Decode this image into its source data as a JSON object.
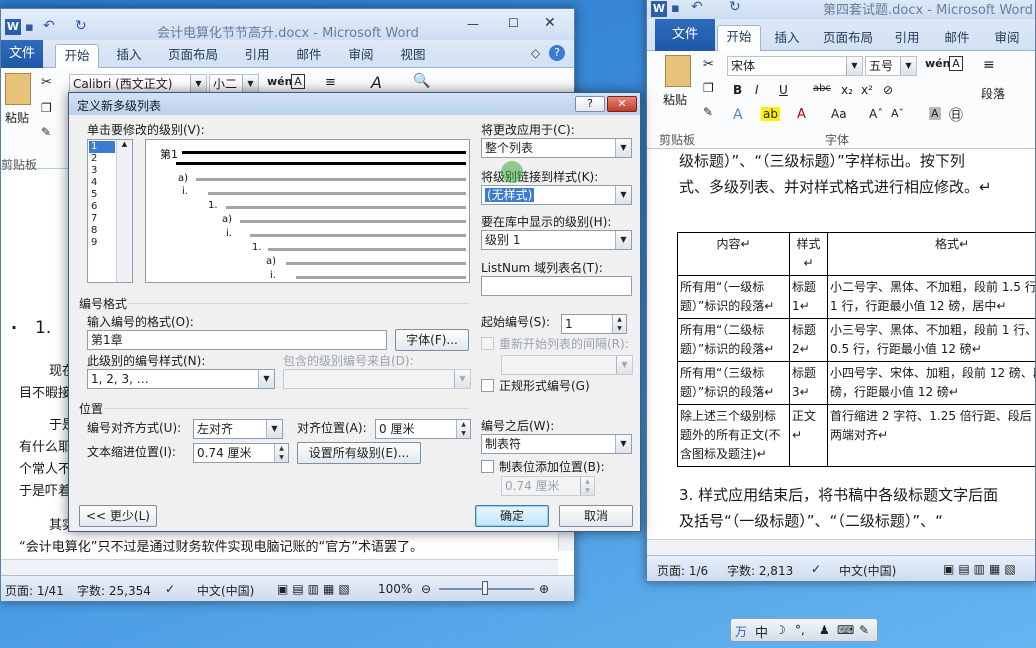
{
  "left_window": {
    "title": "会计电算化节节高升.docx - Microsoft Word",
    "tabs": [
      "文件",
      "开始",
      "插入",
      "页面布局",
      "引用",
      "邮件",
      "审阅",
      "视图"
    ],
    "font_name": "Calibri (西文正文)",
    "font_size": "小二",
    "clipboard_label": "剪贴板",
    "paste_label": "粘贴",
    "doc_heading": "1.",
    "doc_lines": [
      "现在",
      "目不暇接",
      "于是",
      "有什么耶",
      "个常人不",
      "于是吓着"
    ],
    "doc_line_last_prefix": "其实",
    "doc_line_last": "“会计电算化”只不过是通过财务软件实现电脑记账的“官方”术语罢了。",
    "status": {
      "page": "页面: 1/41",
      "words": "字数: 25,354",
      "lang": "中文(中国)",
      "zoom": "100%"
    }
  },
  "right_window": {
    "title": "第四套试题.docx - Microsoft Word",
    "tabs": [
      "文件",
      "开始",
      "插入",
      "页面布局",
      "引用",
      "邮件",
      "审阅"
    ],
    "font_name": "宋体",
    "font_size": "五号",
    "group_clipboard": "剪贴板",
    "group_font": "字体",
    "paste_label": "粘贴",
    "styles_label": "段落",
    "doc_top1": "级标题）”、“（三级标题）”字样标出。按下列",
    "doc_top2": "式、多级列表、并对样式格式进行相应修改。↵",
    "table_headers": [
      "内容↵",
      "样式↵",
      "格式↵"
    ],
    "table_rows": [
      {
        "content": "所有用“（一级标题）”标识的段落↵",
        "style": "标题 1↵",
        "format": "小二号字、黑体、不加粗，段前 1.5 行、段后 1 行，行距最小值 12 磅，居中↵"
      },
      {
        "content": "所有用“（二级标题）”标识的段落↵",
        "style": "标题 2↵",
        "format": "小三号字、黑体、不加粗，段前 1 行、段后 0.5 行，行距最小值 12 磅↵"
      },
      {
        "content": "所有用“（三级标题）”标识的段落↵",
        "style": "标题 3↵",
        "format": "小四号字、宋体、加粗，段前 12 磅、段后 6 磅，行距最小值 12 磅↵"
      },
      {
        "content": "除上述三个级别标题外的所有正文(不含图标及题注)↵",
        "style": "正文↵",
        "format": "首行缩进 2 字符、1.25 倍行距、段后 6 磅、两端对齐↵"
      }
    ],
    "doc_bottom1": "3. 样式应用结束后，将书稿中各级标题文字后面",
    "doc_bottom2": "及括号“（一级标题）”、“（二级标题）”、“",
    "status": {
      "page": "页面: 1/6",
      "words": "字数: 2,813",
      "lang": "中文(中国)"
    }
  },
  "dialog": {
    "title": "定义新多级列表",
    "help": "?",
    "close": "✕",
    "level_label": "单击要修改的级别(V):",
    "levels": [
      "1",
      "2",
      "3",
      "4",
      "5",
      "6",
      "7",
      "8",
      "9"
    ],
    "selected_level": "1",
    "preview": {
      "first": "第1",
      "labels": [
        "a)",
        "i.",
        "1.",
        "a)",
        "i.",
        "1.",
        "a)",
        "i."
      ]
    },
    "apply_to_label": "将更改应用于(C):",
    "apply_to_value": "整个列表",
    "link_style_label": "将级别链接到样式(K):",
    "link_style_value": "(无样式)",
    "gallery_level_label": "要在库中显示的级别(H):",
    "gallery_level_value": "级别 1",
    "listnum_label": "ListNum 域列表名(T):",
    "listnum_value": "",
    "number_format_section": "编号格式",
    "enter_format_label": "输入编号的格式(O):",
    "enter_format_value": "第1章",
    "font_button": "字体(F)...",
    "number_style_label": "此级别的编号样式(N):",
    "number_style_value": "1, 2, 3, …",
    "include_level_label": "包含的级别编号来自(D):",
    "start_at_label": "起始编号(S):",
    "start_at_value": "1",
    "restart_label": "重新开始列表的间隔(R):",
    "legal_label": "正规形式编号(G)",
    "position_section": "位置",
    "alignment_label": "编号对齐方式(U):",
    "alignment_value": "左对齐",
    "align_at_label": "对齐位置(A):",
    "align_at_value": "0 厘米",
    "indent_label": "文本缩进位置(I):",
    "indent_value": "0.74 厘米",
    "set_all_button": "设置所有级别(E)...",
    "follow_label": "编号之后(W):",
    "follow_value": "制表符",
    "tab_stop_label": "制表位添加位置(B):",
    "tab_stop_value": "0.74 厘米",
    "less_button": "<< 更少(L)",
    "ok_button": "确定",
    "cancel_button": "取消"
  },
  "ime_bar": {
    "text": "中"
  }
}
